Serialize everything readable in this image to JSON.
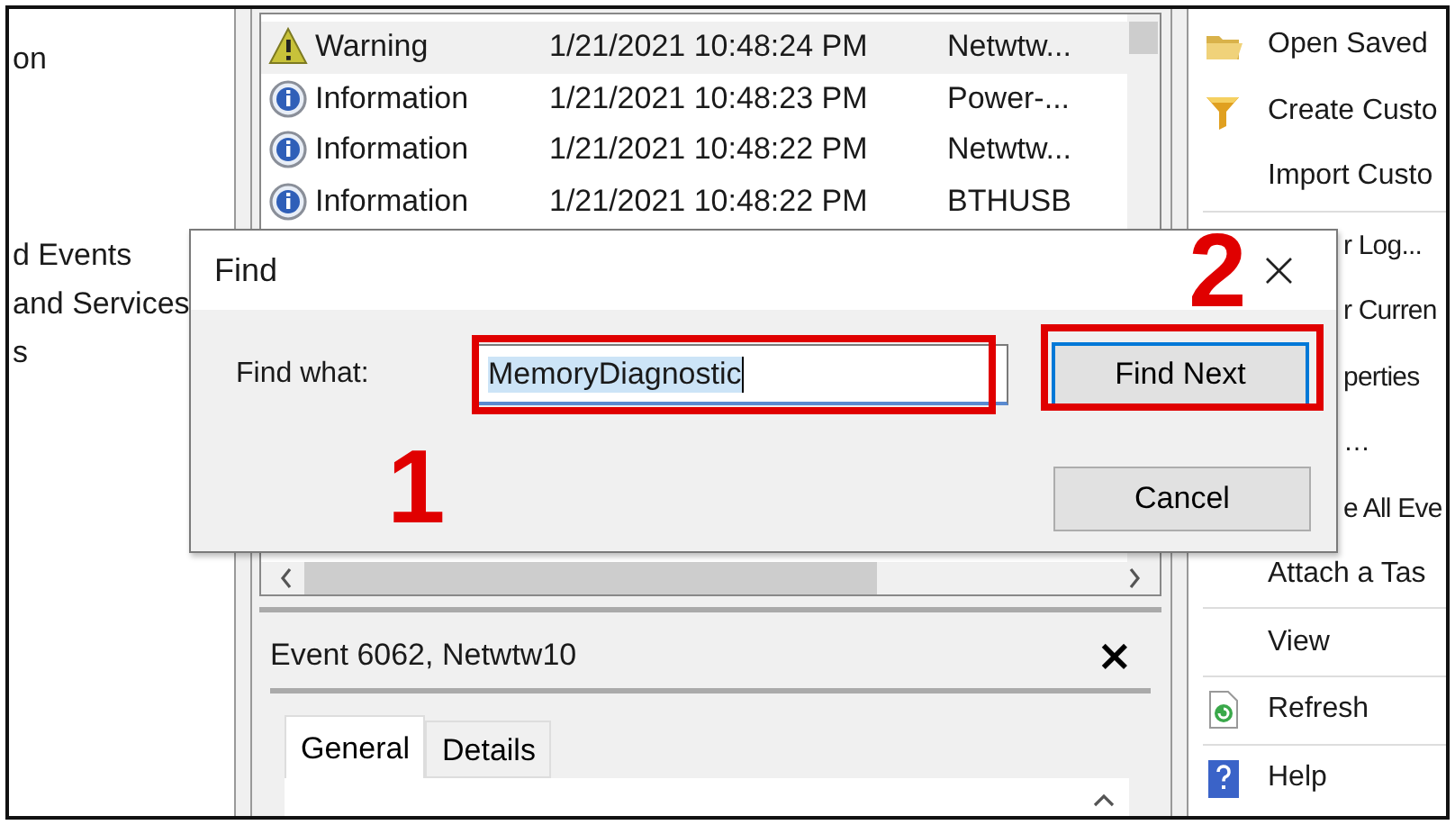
{
  "navigation_pane": {
    "items": [
      {
        "label": "on"
      },
      {
        "label": "d Events"
      },
      {
        "label": "and Services"
      },
      {
        "label": "s"
      }
    ]
  },
  "event_list": {
    "rows": [
      {
        "kind": "warning",
        "level": "Warning",
        "date_time": "1/21/2021 10:48:24 PM",
        "source": "Netwtw...",
        "selected": true
      },
      {
        "kind": "information",
        "level": "Information",
        "date_time": "1/21/2021 10:48:23 PM",
        "source": "Power-...",
        "selected": false
      },
      {
        "kind": "information",
        "level": "Information",
        "date_time": "1/21/2021 10:48:22 PM",
        "source": "Netwtw...",
        "selected": false
      },
      {
        "kind": "information",
        "level": "Information",
        "date_time": "1/21/2021 10:48:22 PM",
        "source": "BTHUSB",
        "selected": false
      }
    ]
  },
  "event_details": {
    "title": "Event 6062, Netwtw10",
    "close": "×",
    "tabs": [
      {
        "label": "General",
        "selected": true
      },
      {
        "label": "Details",
        "selected": false
      }
    ]
  },
  "actions": [
    {
      "label": "Open Saved",
      "kind": "folder",
      "separator_after": false
    },
    {
      "label": "Create Custo",
      "kind": "filter",
      "separator_after": false
    },
    {
      "label": "Import Custo",
      "kind": "plain",
      "separator_after": true
    },
    {
      "label": "r Log...",
      "kind": "clipped",
      "separator_after": false
    },
    {
      "label": "r Curren",
      "kind": "clipped",
      "separator_after": false
    },
    {
      "label": "perties",
      "kind": "clipped",
      "separator_after": false
    },
    {
      "label": "…",
      "kind": "clipped",
      "separator_after": false
    },
    {
      "label": "e All Eve",
      "kind": "clipped",
      "separator_after": false
    },
    {
      "label": "Attach a Tas",
      "kind": "plain",
      "separator_after": true
    },
    {
      "label": "View",
      "kind": "plain",
      "separator_after": true
    },
    {
      "label": "Refresh",
      "kind": "refresh",
      "separator_after": true
    },
    {
      "label": "Help",
      "kind": "help",
      "separator_after": false
    }
  ],
  "find_dialog": {
    "title": "Find",
    "close": "×",
    "field_label": "Find what:",
    "field_value": "MemoryDiagnostic",
    "text_selected": true,
    "buttons": [
      {
        "label": "Find Next",
        "default": true
      },
      {
        "label": "Cancel",
        "default": false
      }
    ]
  },
  "annotations": [
    {
      "label": "1"
    },
    {
      "label": "2"
    }
  ]
}
